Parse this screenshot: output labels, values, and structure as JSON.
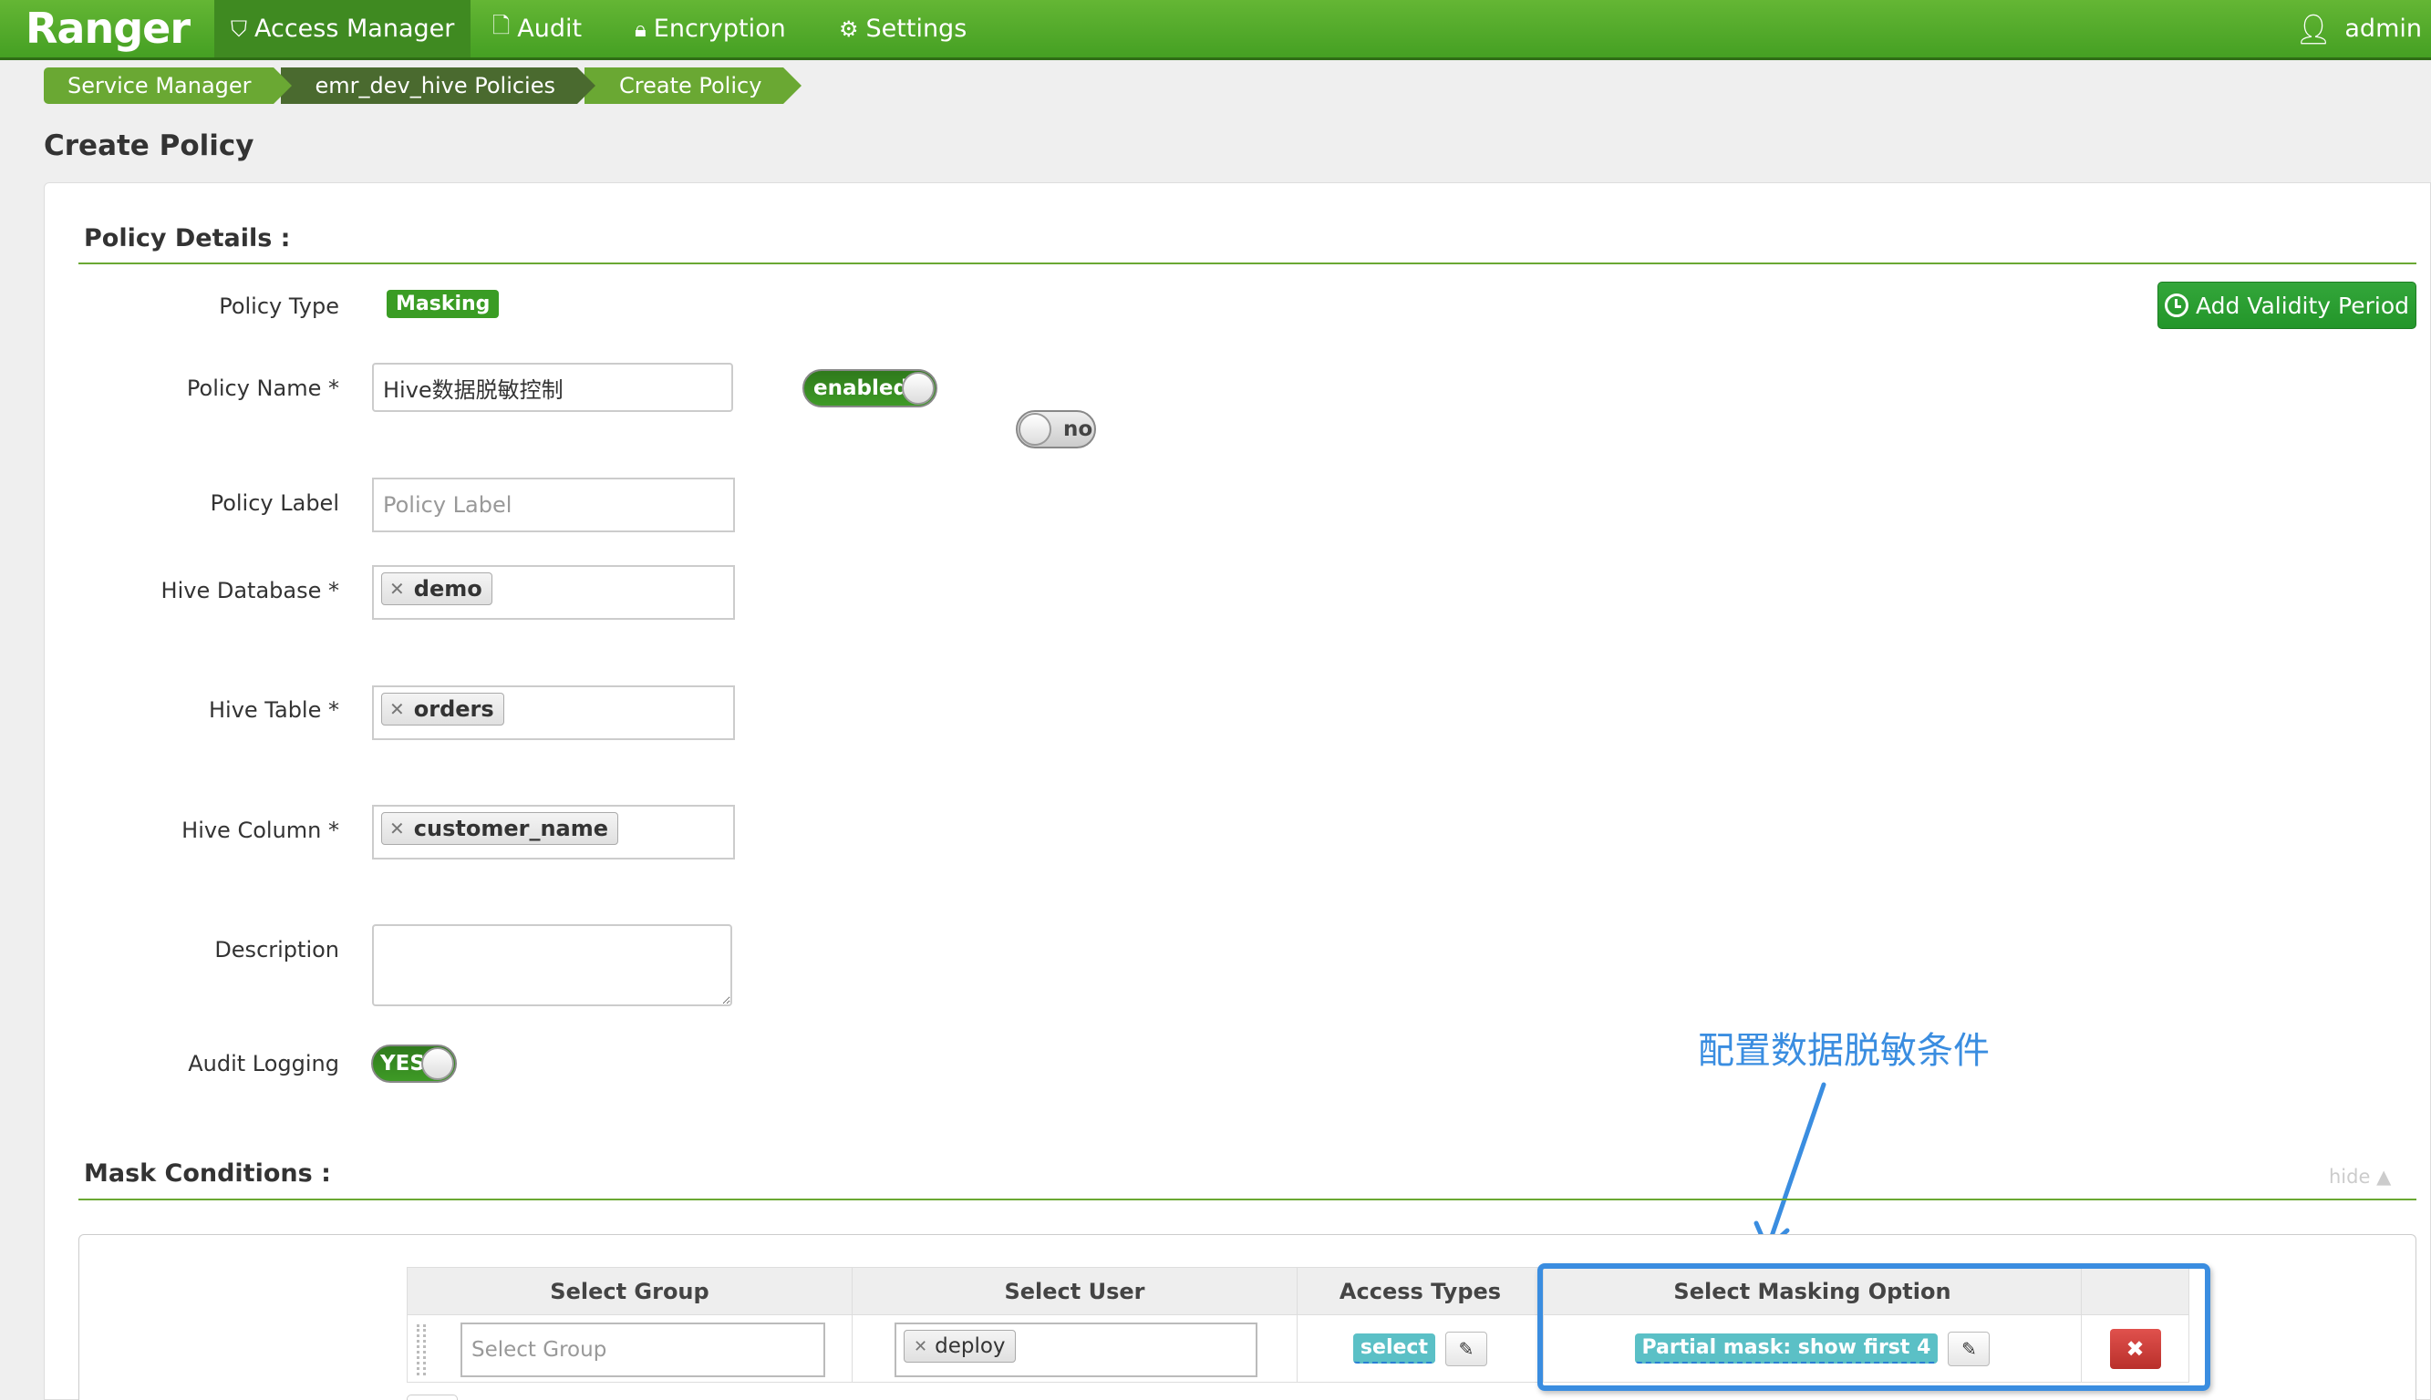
{
  "navbar": {
    "brand": "Ranger",
    "items": [
      {
        "label": "Access Manager",
        "icon": "shield-icon",
        "active": true
      },
      {
        "label": "Audit",
        "icon": "file-icon",
        "active": false
      },
      {
        "label": "Encryption",
        "icon": "lock-icon",
        "active": false
      },
      {
        "label": "Settings",
        "icon": "gear-icon",
        "active": false
      }
    ],
    "user": "admin"
  },
  "breadcrumb": [
    "Service Manager",
    "emr_dev_hive Policies",
    "Create Policy"
  ],
  "page_title": "Create Policy",
  "policy_details": {
    "title": "Policy Details :",
    "policy_type_label": "Policy Type",
    "policy_type": "Masking",
    "add_validity_label": "Add Validity Period",
    "policy_name_label": "Policy Name *",
    "policy_name": "Hive数据脱敏控制",
    "enabled_toggle": "enabled",
    "override_toggle": "nor",
    "policy_label_label": "Policy Label",
    "policy_label_placeholder": "Policy Label",
    "hive_database_label": "Hive Database *",
    "hive_database": "demo",
    "hive_table_label": "Hive Table *",
    "hive_table": "orders",
    "hive_column_label": "Hive Column *",
    "hive_column": "customer_name",
    "description_label": "Description",
    "description": "",
    "audit_logging_label": "Audit Logging",
    "audit_logging": "YES"
  },
  "mask_conditions": {
    "title": "Mask Conditions :",
    "hide_label": "hide ▲",
    "headers": [
      "Select Group",
      "Select User",
      "Access Types",
      "Select Masking Option",
      ""
    ],
    "rows": [
      {
        "group_placeholder": "Select Group",
        "user": "deploy",
        "access_type": "select",
        "masking_option": "Partial mask: show first 4"
      }
    ]
  },
  "annotation": {
    "text": "配置数据脱敏条件",
    "color": "#3a8de0"
  },
  "colors": {
    "nav_green": "#4fa62a",
    "section_rule": "#6aa833",
    "danger": "#c9302c",
    "teal": "#5bc0c6"
  }
}
